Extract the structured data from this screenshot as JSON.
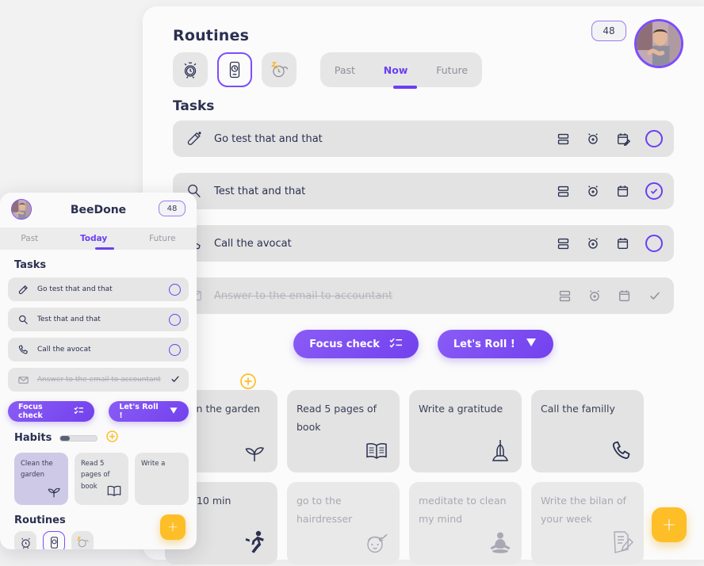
{
  "colors": {
    "accent": "#6b3ff0",
    "accent_soft": "#8a5cf5",
    "fab": "#fdbe28",
    "page_bg": "#f2f2f2",
    "card_bg": "#fbfbfb",
    "row_bg": "#e3e3e3",
    "text": "#2b3050",
    "muted": "#a9a9b4"
  },
  "desktop": {
    "header": {
      "title": "Routines",
      "badge": "48",
      "routine_icons": [
        {
          "name": "alarm-clock-icon",
          "selected": false
        },
        {
          "name": "mobile-routine-icon",
          "selected": true
        },
        {
          "name": "snooze-clock-icon",
          "selected": false
        }
      ],
      "tabs": [
        {
          "label": "Past",
          "active": false
        },
        {
          "label": "Now",
          "active": true
        },
        {
          "label": "Future",
          "active": false
        }
      ]
    },
    "tasks_title": "Tasks",
    "tasks": [
      {
        "icon": "test-tube-icon",
        "label": "Go test that and that",
        "done": false,
        "checked": false
      },
      {
        "icon": "magnifier-icon",
        "label": "Test that and that",
        "done": false,
        "checked": true
      },
      {
        "icon": "phone-icon",
        "label": "Call the avocat",
        "done": false,
        "checked": false
      },
      {
        "icon": "envelope-icon",
        "label": "Answer to the email to accountant",
        "done": true,
        "checked": true
      }
    ],
    "row_actions": [
      "subtask-icon",
      "alarm-add-icon",
      "calendar-edit-icon"
    ],
    "buttons": {
      "focus_check": "Focus check",
      "lets_roll": "Let's Roll !"
    },
    "add_habit_icon": "plus-circle-icon",
    "habits": [
      {
        "name": "Clean the garden",
        "icon": "sprout-icon",
        "dim": false
      },
      {
        "name": "Read 5 pages of book",
        "icon": "open-book-icon",
        "dim": false
      },
      {
        "name": "Write a gratitude",
        "icon": "praying-hands-icon",
        "dim": false
      },
      {
        "name": "Call the familly",
        "icon": "phone-icon",
        "dim": false
      },
      {
        "name": "Run 10 min",
        "icon": "running-icon",
        "dim": false
      },
      {
        "name": "go to the hairdresser",
        "icon": "hairdresser-icon",
        "dim": true
      },
      {
        "name": "meditate to clean my mind",
        "icon": "meditation-icon",
        "dim": true
      },
      {
        "name": "Write the bilan of your week",
        "icon": "notepad-edit-icon",
        "dim": true
      }
    ],
    "fab_label": "+"
  },
  "mobile": {
    "title": "BeeDone",
    "badge": "48",
    "tabs": [
      {
        "label": "Past",
        "active": false
      },
      {
        "label": "Today",
        "active": true
      },
      {
        "label": "Future",
        "active": false
      }
    ],
    "tasks_title": "Tasks",
    "tasks": [
      {
        "icon": "test-tube-icon",
        "label": "Go test that and that",
        "done": false
      },
      {
        "icon": "magnifier-icon",
        "label": "Test that and that",
        "done": false
      },
      {
        "icon": "phone-icon",
        "label": "Call the avocat",
        "done": false
      },
      {
        "icon": "envelope-icon",
        "label": "Answer to the email to accountant",
        "done": true
      }
    ],
    "buttons": {
      "focus_check": "Focus check",
      "lets_roll": "Let's Roll !"
    },
    "habits_title": "Habits",
    "habits_progress_percent": 25,
    "add_habit_icon": "plus-circle-icon",
    "habits": [
      {
        "name": "Clean the garden",
        "icon": "sprout-icon",
        "active": true
      },
      {
        "name": "Read 5 pages of book",
        "icon": "open-book-icon",
        "active": false
      },
      {
        "name": "Write a",
        "icon": "none",
        "active": false
      }
    ],
    "routines_title": "Routines",
    "routine_icons": [
      {
        "name": "alarm-clock-icon",
        "selected": false
      },
      {
        "name": "mobile-routine-icon",
        "selected": true
      },
      {
        "name": "snooze-clock-icon",
        "selected": false
      }
    ],
    "fab_label": "+"
  }
}
